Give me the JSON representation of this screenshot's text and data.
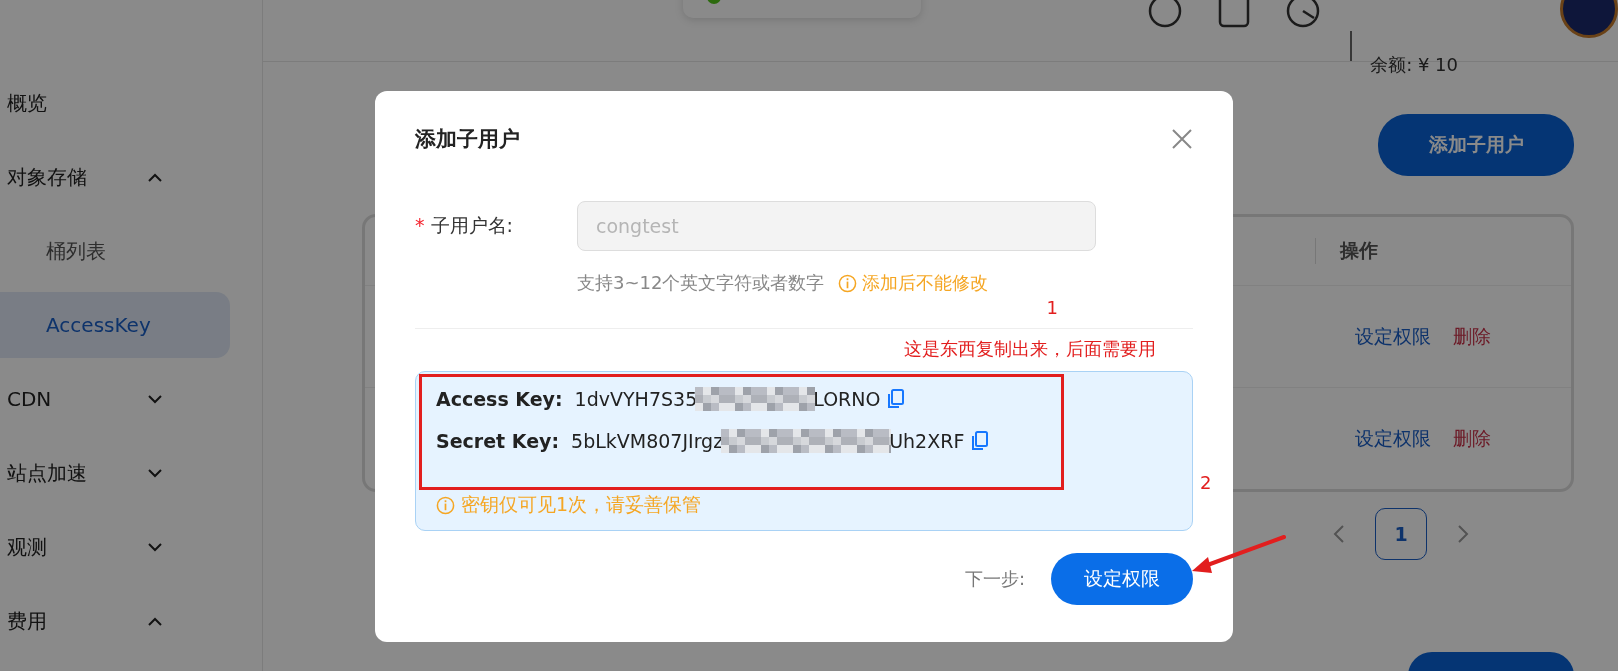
{
  "header": {
    "balance": "余额: ¥ 10"
  },
  "sidebar": {
    "items": [
      {
        "label": "概览",
        "selected": false
      },
      {
        "label": "对象存储",
        "expanded": true,
        "selected": false,
        "children": [
          {
            "label": "桶列表",
            "selected": false
          },
          {
            "label": "AccessKey",
            "selected": true
          }
        ]
      },
      {
        "label": "CDN",
        "expanded": false,
        "selected": false
      },
      {
        "label": "站点加速",
        "expanded": false,
        "selected": false
      },
      {
        "label": "观测",
        "expanded": false,
        "selected": false
      },
      {
        "label": "费用",
        "expanded": true,
        "selected": false
      }
    ]
  },
  "page": {
    "add_button": "添加子用户",
    "table": {
      "columns": [
        "操作"
      ],
      "rows": [
        {
          "actions": [
            "设定权限",
            "删除"
          ]
        },
        {
          "actions": [
            "设定权限",
            "删除"
          ]
        }
      ]
    },
    "pagination": {
      "pages": [
        {
          "label": "1",
          "selected": true
        }
      ]
    }
  },
  "dialog": {
    "title": "添加子用户",
    "username": {
      "label": "子用户名:",
      "required_mark": "*",
      "placeholder": "congtest",
      "disabled": true
    },
    "hint": "支持3~12个英文字符或者数字",
    "warning": "添加后不能修改",
    "keys": [
      {
        "label": "Access Key:",
        "value_start": "1dvVYH7S35",
        "value_end": "LORNO"
      },
      {
        "label": "Secret Key:",
        "value_start": "5bLkVM807JIrgz",
        "value_end": "Uh2XRF"
      }
    ],
    "key_warning": "密钥仅可见1次，请妥善保管",
    "next_label": "下一步:",
    "next_button": "设定权限"
  },
  "annotations": {
    "mark_1": "1",
    "note": "这是东西复制出来，后面需要用",
    "mark_2": "2"
  }
}
